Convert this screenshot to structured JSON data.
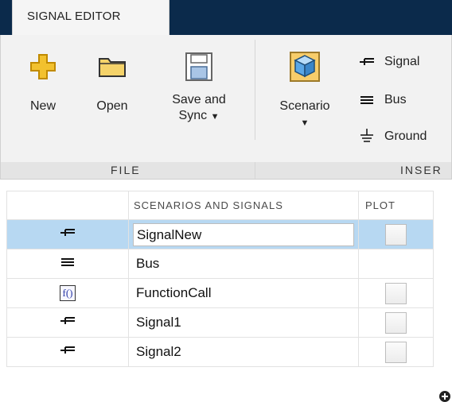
{
  "tabs": {
    "active": "SIGNAL EDITOR"
  },
  "ribbon": {
    "file": {
      "section_label": "FILE",
      "buttons": {
        "new": "New",
        "open": "Open",
        "save_line1": "Save and",
        "save_line2": "Sync"
      }
    },
    "insert": {
      "section_label": "INSER",
      "scenario": "Scenario",
      "signal": "Signal",
      "bus": "Bus",
      "ground": "Ground"
    },
    "caret": "▼"
  },
  "table": {
    "headers": {
      "name": "SCENARIOS AND SIGNALS",
      "plot": "PLOT"
    },
    "rows": [
      {
        "icon": "signal-icon",
        "name": "SignalNew",
        "plot": true,
        "selected": true,
        "editing": true
      },
      {
        "icon": "bus-icon",
        "name": "Bus",
        "plot": false,
        "selected": false,
        "editing": false
      },
      {
        "icon": "function-call-icon",
        "name": "FunctionCall",
        "plot": true,
        "selected": false,
        "editing": false
      },
      {
        "icon": "signal-icon",
        "name": "Signal1",
        "plot": true,
        "selected": false,
        "editing": false
      },
      {
        "icon": "signal-icon",
        "name": "Signal2",
        "plot": true,
        "selected": false,
        "editing": false
      }
    ]
  },
  "colors": {
    "tabstrip": "#0b2a4b",
    "selection": "#b7d8f2",
    "new_icon": "#f2c12e",
    "folder_icon": "#f5d36a",
    "scenario_cube": "#5aa7e6"
  },
  "function_icon_text": "f()"
}
